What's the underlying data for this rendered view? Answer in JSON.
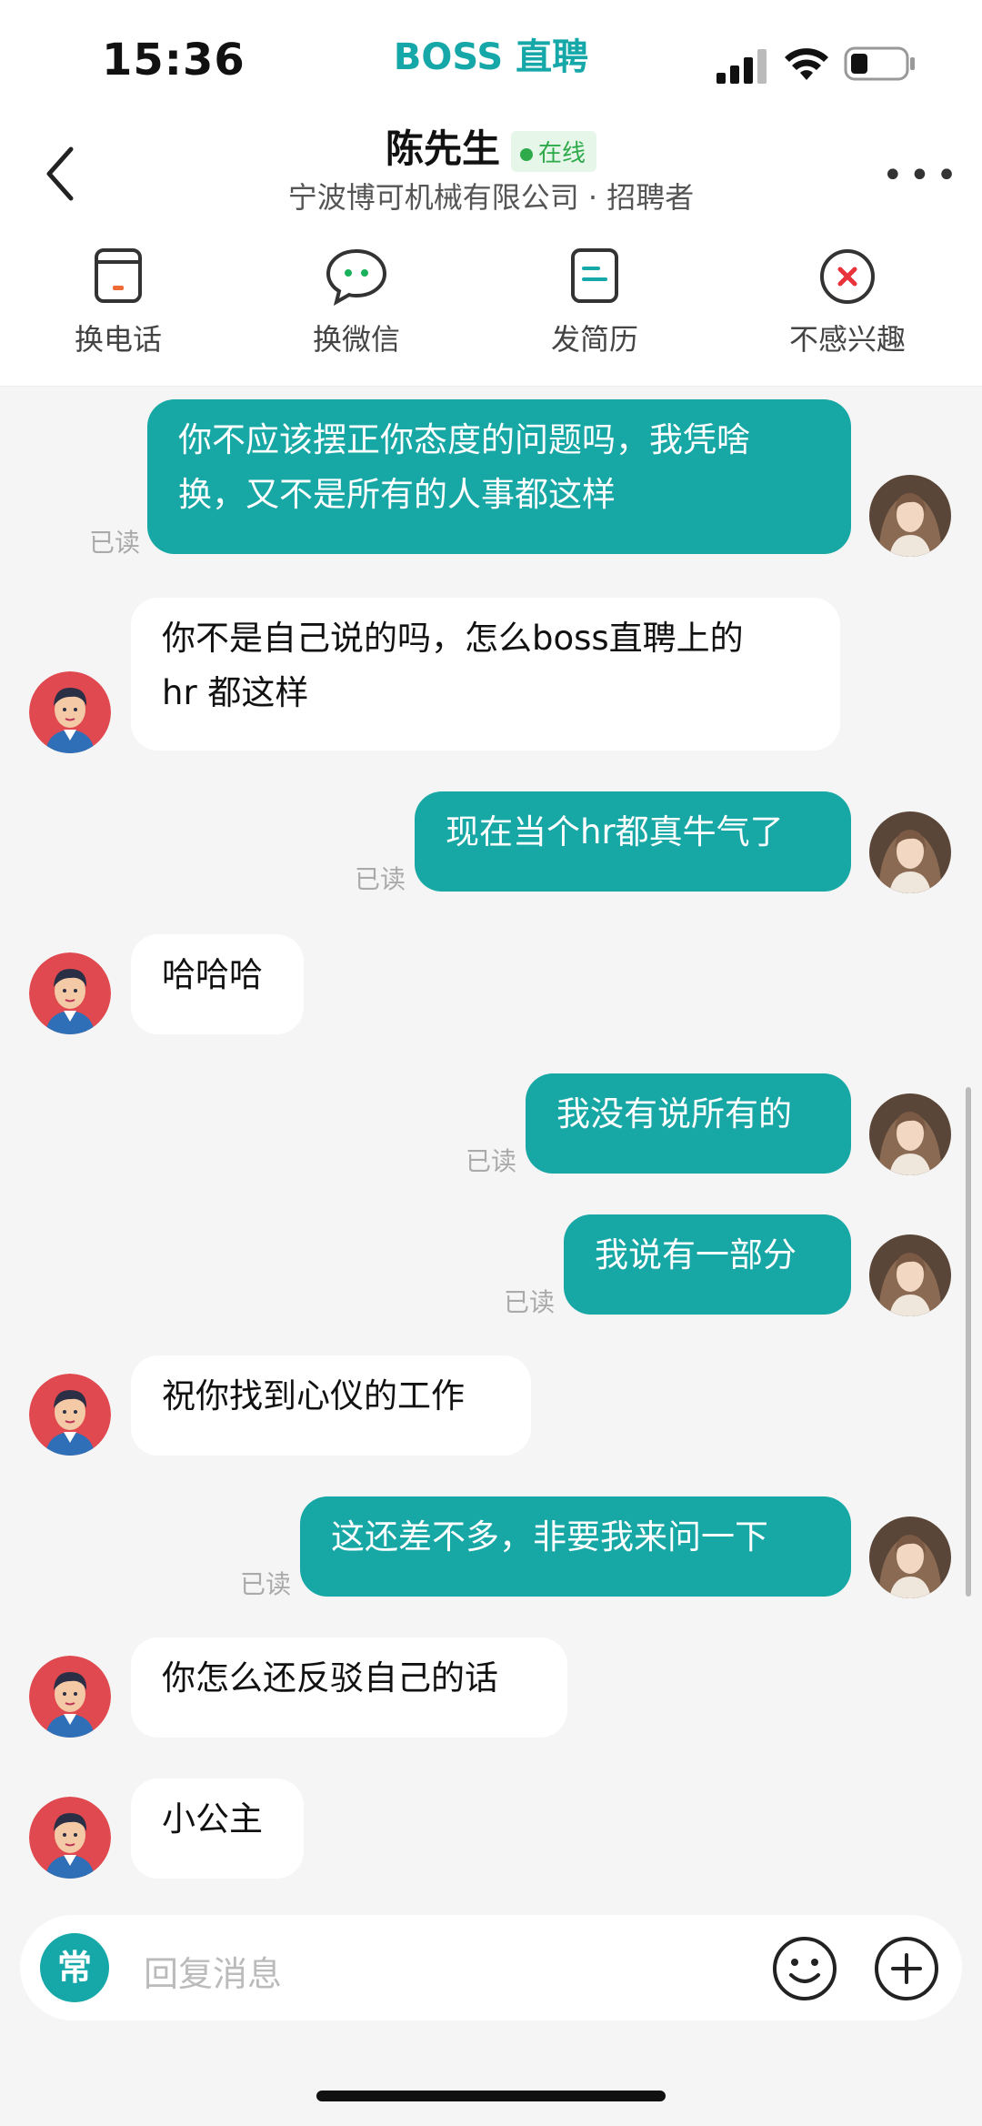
{
  "status_bar": {
    "time": "15:36",
    "app_brand": "BOSS 直聘"
  },
  "header": {
    "contact_name": "陈先生",
    "online_status": "在线",
    "subtitle": "宁波博可机械有限公司 · 招聘者"
  },
  "actions": [
    {
      "label": "换电话",
      "icon": "phone-card-icon"
    },
    {
      "label": "换微信",
      "icon": "wechat-bubble-icon"
    },
    {
      "label": "发简历",
      "icon": "resume-icon"
    },
    {
      "label": "不感兴趣",
      "icon": "not-interested-icon"
    }
  ],
  "messages": [
    {
      "side": "me",
      "lines": [
        "你不应该摆正你态度的问题吗，我凭啥",
        "换，又不是所有的人事都这样"
      ],
      "read": "已读"
    },
    {
      "side": "them",
      "lines": [
        "你不是自己说的吗，怎么boss直聘上的",
        "hr 都这样"
      ]
    },
    {
      "side": "me",
      "lines": [
        "现在当个hr都真牛气了"
      ],
      "read": "已读"
    },
    {
      "side": "them",
      "lines": [
        "哈哈哈"
      ]
    },
    {
      "side": "me",
      "lines": [
        "我没有说所有的"
      ],
      "read": "已读"
    },
    {
      "side": "me",
      "lines": [
        "我说有一部分"
      ],
      "read": "已读"
    },
    {
      "side": "them",
      "lines": [
        "祝你找到心仪的工作"
      ]
    },
    {
      "side": "me",
      "lines": [
        "这还差不多，非要我来问一下"
      ],
      "read": "已读"
    },
    {
      "side": "them",
      "lines": [
        "你怎么还反驳自己的话"
      ]
    },
    {
      "side": "them",
      "lines": [
        "小公主"
      ]
    }
  ],
  "input": {
    "quick_reply_label": "常",
    "placeholder": "回复消息"
  },
  "colors": {
    "brand": "#16a8a8",
    "my_bubble": "#17a7a5",
    "online": "#2eaa4a"
  }
}
